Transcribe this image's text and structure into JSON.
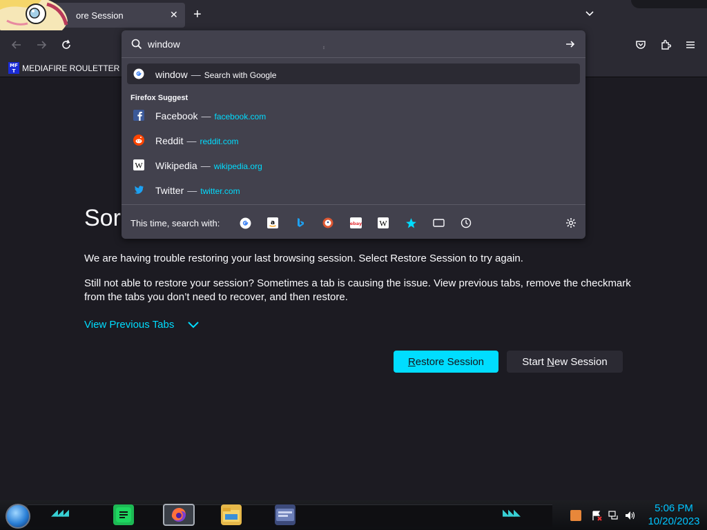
{
  "tab": {
    "title": "ore Session",
    "close": "✕"
  },
  "newtab": "+",
  "bookmarks": {
    "icon_text": "MF T",
    "label": "MEDIAFIRE ROULETTER"
  },
  "urlbar": {
    "value": "window"
  },
  "results": {
    "google": {
      "term": "window",
      "dash": "—",
      "sub": "Search with Google"
    },
    "suggest_header": "Firefox Suggest",
    "items": [
      {
        "name": "Facebook",
        "url": "facebook.com",
        "icon": "facebook-icon"
      },
      {
        "name": "Reddit",
        "url": "reddit.com",
        "icon": "reddit-icon"
      },
      {
        "name": "Wikipedia",
        "url": "wikipedia.org",
        "icon": "wikipedia-icon"
      },
      {
        "name": "Twitter",
        "url": "twitter.com",
        "icon": "twitter-icon"
      }
    ],
    "dash": "—",
    "search_with_label": "This time, search with:",
    "engines": [
      "google",
      "amazon",
      "bing",
      "duckduckgo",
      "ebay",
      "wikipedia",
      "bookmarks",
      "tabs",
      "history"
    ]
  },
  "content": {
    "heading_visible": "Sorr",
    "msg1": "We are having trouble restoring your last browsing session. Select Restore Session to try again.",
    "msg2": "Still not able to restore your session? Sometimes a tab is causing the issue. View previous tabs, remove the checkmark from the tabs you don’t need to recover, and then restore.",
    "view_prev": "View Previous Tabs",
    "restore_pre": "",
    "restore_u": "R",
    "restore_post": "estore Session",
    "new_pre": "Start ",
    "new_u": "N",
    "new_post": "ew Session"
  },
  "clock": {
    "time": "5:06 PM",
    "date": "10/20/2023"
  },
  "colors": {
    "accent": "#00ddff",
    "panel": "#42414d",
    "bg": "#1c1b22",
    "toolbar": "#2b2a33"
  }
}
